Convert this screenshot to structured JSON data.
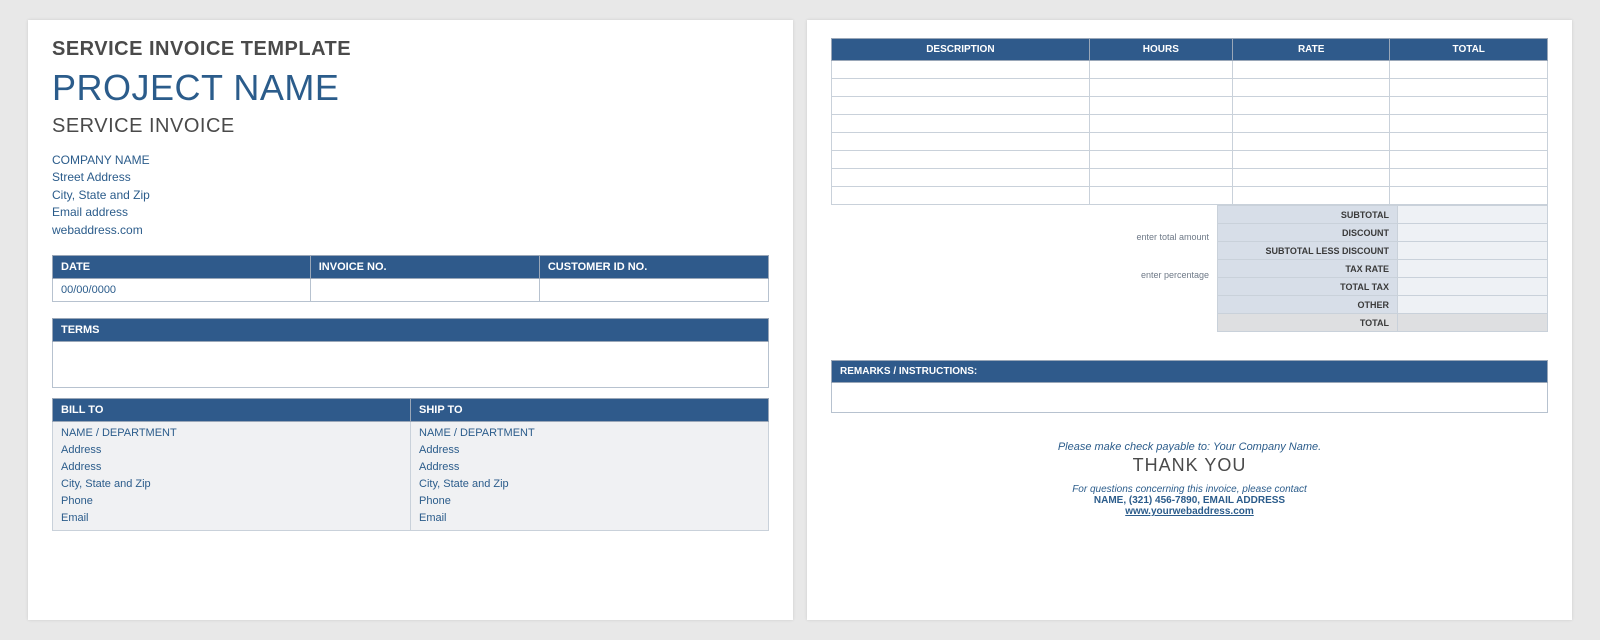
{
  "page1": {
    "template_title": "SERVICE INVOICE TEMPLATE",
    "project_name": "PROJECT NAME",
    "sub_title": "SERVICE INVOICE",
    "company": {
      "name": "COMPANY NAME",
      "street": "Street Address",
      "csz": "City, State and Zip",
      "email": "Email address",
      "web": "webaddress.com"
    },
    "meta": {
      "date_label": "DATE",
      "invoice_label": "INVOICE NO.",
      "customer_label": "CUSTOMER ID NO.",
      "date_value": "00/00/0000",
      "invoice_value": "",
      "customer_value": ""
    },
    "terms_label": "TERMS",
    "billto_label": "BILL TO",
    "shipto_label": "SHIP TO",
    "addr_lines": [
      "NAME / DEPARTMENT",
      "Address",
      "Address",
      "City, State and Zip",
      "Phone",
      "Email"
    ]
  },
  "page2": {
    "cols": {
      "desc": "DESCRIPTION",
      "hours": "HOURS",
      "rate": "RATE",
      "total": "TOTAL"
    },
    "row_count": 8,
    "hints": {
      "amount": "enter total amount",
      "pct": "enter percentage"
    },
    "totals_labels": [
      "SUBTOTAL",
      "DISCOUNT",
      "SUBTOTAL LESS DISCOUNT",
      "TAX RATE",
      "TOTAL TAX",
      "OTHER",
      "TOTAL"
    ],
    "remarks_label": "REMARKS / INSTRUCTIONS:",
    "footer": {
      "payable": "Please make check payable to: Your Company Name.",
      "thanks": "THANK YOU",
      "questions": "For questions concerning this invoice, please contact",
      "contact": "NAME, (321) 456-7890, EMAIL ADDRESS",
      "url": "www.yourwebaddress.com"
    }
  }
}
